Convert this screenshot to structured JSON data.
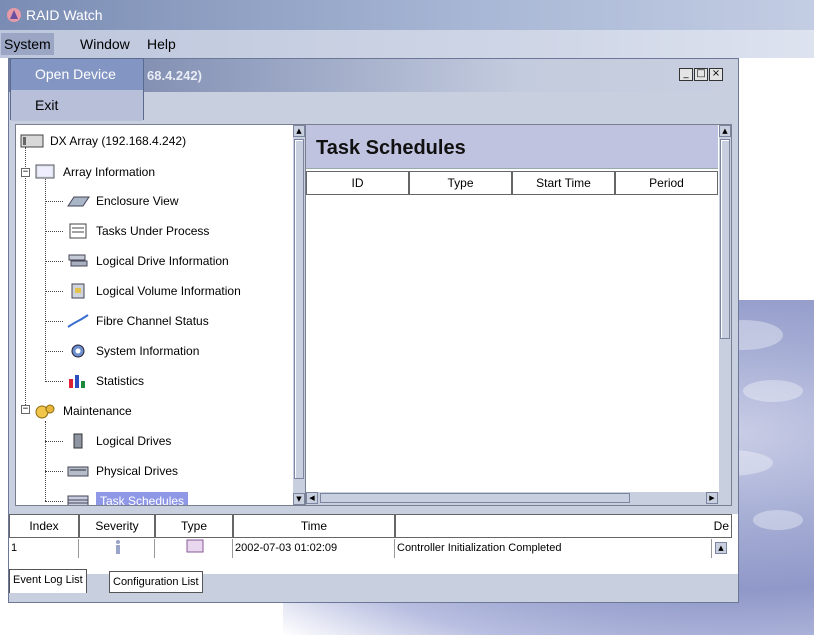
{
  "app": {
    "title": "RAID Watch"
  },
  "menubar": {
    "items": [
      "System",
      "Window",
      "Help"
    ]
  },
  "system_menu": {
    "items": [
      "Open Device",
      "Exit"
    ]
  },
  "window": {
    "title_partial": "68.4.242)",
    "ctrl_min": "_",
    "ctrl_max": "□",
    "ctrl_close": "×"
  },
  "tree": {
    "items": [
      {
        "label": "DX Array (192.168.4.242)",
        "icon": "array-icon"
      },
      {
        "label": "Array Information",
        "icon": "monitor-icon"
      },
      {
        "label": "Enclosure View",
        "icon": "enclosure-icon"
      },
      {
        "label": "Tasks Under Process",
        "icon": "tasks-icon"
      },
      {
        "label": "Logical Drive Information",
        "icon": "logical-drive-icon"
      },
      {
        "label": "Logical Volume Information",
        "icon": "logical-volume-icon"
      },
      {
        "label": "Fibre Channel Status",
        "icon": "fibre-channel-icon"
      },
      {
        "label": "System Information",
        "icon": "system-info-icon"
      },
      {
        "label": "Statistics",
        "icon": "statistics-icon"
      },
      {
        "label": "Maintenance",
        "icon": "maintenance-icon"
      },
      {
        "label": "Logical Drives",
        "icon": "drive-icon"
      },
      {
        "label": "Physical Drives",
        "icon": "physical-drive-icon"
      },
      {
        "label": "Task Schedules",
        "icon": "schedule-icon"
      }
    ],
    "expander_minus": "−"
  },
  "task_schedules": {
    "title": "Task Schedules",
    "columns": [
      "ID",
      "Type",
      "Start Time",
      "Period"
    ]
  },
  "event_log": {
    "columns": [
      "Index",
      "Severity",
      "Type",
      "Time",
      "De"
    ],
    "rows": [
      {
        "index": "1",
        "time": "2002-07-03 01:02:09",
        "description": "Controller Initialization Completed"
      }
    ]
  },
  "tabs": [
    "Event Log List",
    "Configuration List"
  ],
  "colors": {
    "accent": "#7a8cb3",
    "selection": "#8f98e6",
    "header_bg": "#c0c3df"
  }
}
